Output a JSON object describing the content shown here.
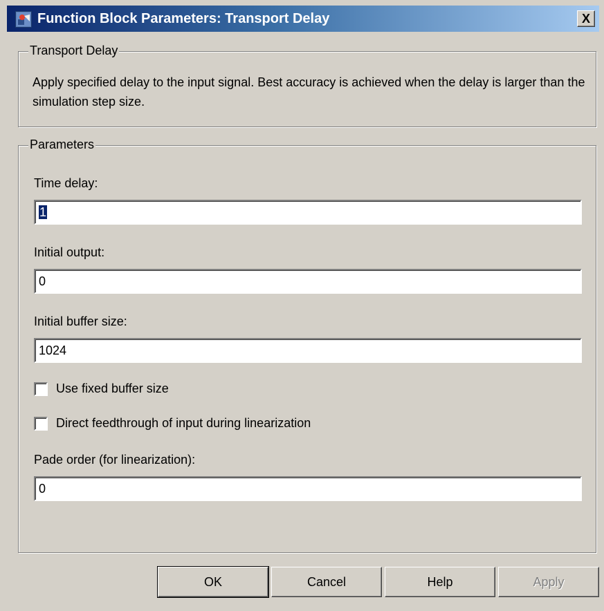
{
  "window": {
    "title": "Function Block Parameters: Transport Delay",
    "close_label": "X"
  },
  "block_group": {
    "legend": "Transport Delay",
    "description": "Apply specified delay to the input signal.  Best accuracy is achieved when the delay is larger than the simulation step size."
  },
  "params_group": {
    "legend": "Parameters",
    "time_delay": {
      "label": "Time delay:",
      "value": "1"
    },
    "initial_output": {
      "label": "Initial output:",
      "value": "0"
    },
    "initial_buffer_size": {
      "label": "Initial buffer size:",
      "value": "1024"
    },
    "use_fixed_buffer": {
      "label": "Use fixed buffer size",
      "checked": false
    },
    "direct_feedthrough": {
      "label": "Direct feedthrough of input during linearization",
      "checked": false
    },
    "pade_order": {
      "label": "Pade order (for linearization):",
      "value": "0"
    }
  },
  "buttons": {
    "ok": "OK",
    "cancel": "Cancel",
    "help": "Help",
    "apply": "Apply"
  },
  "colors": {
    "titlebar_start": "#0a246a",
    "titlebar_end": "#a6caf0",
    "dialog_bg": "#d4d0c8"
  }
}
